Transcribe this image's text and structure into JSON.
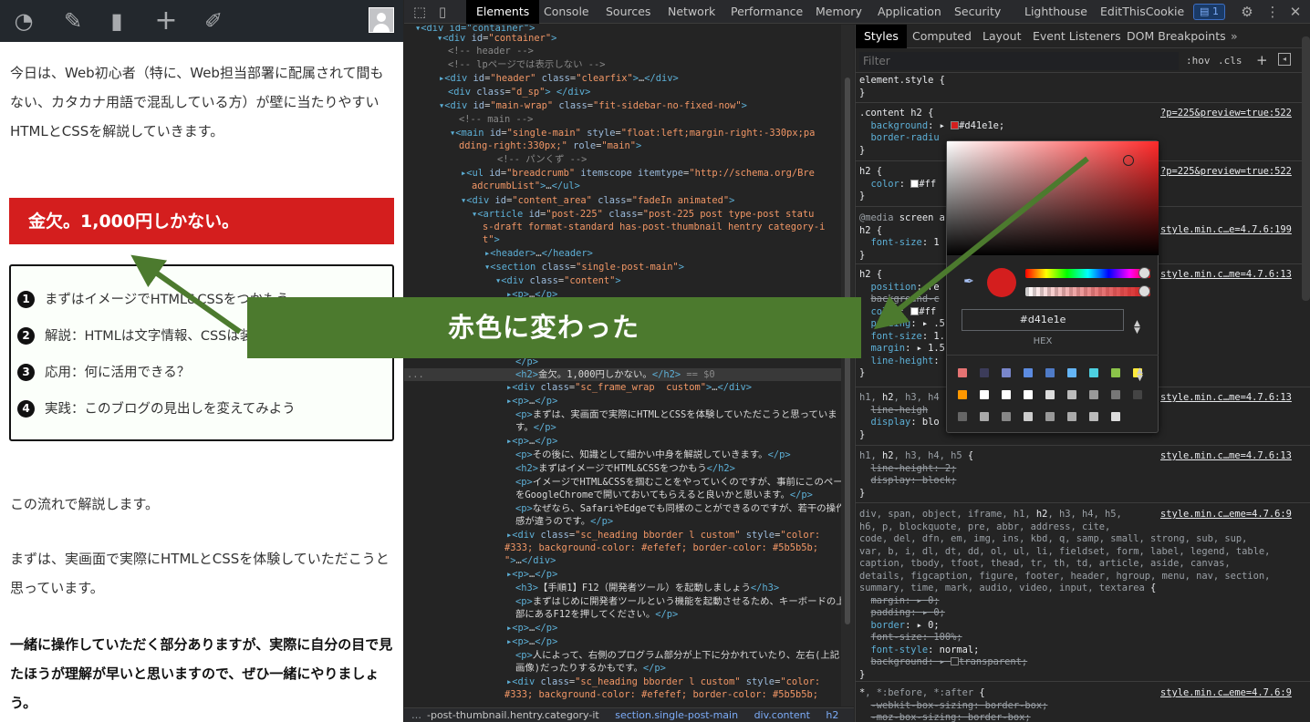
{
  "article": {
    "intro": "今日は、Web初心者（特に、Web担当部署に配属されて間もない、カタカナ用語で混乱している方）が壁に当たりやすいHTMLとCSSを解説していきます。",
    "heading": "金欠。1,000円しかない。",
    "toc": [
      {
        "num": "1",
        "text": "まずはイメージでHTML&CSSをつかもう"
      },
      {
        "num": "2",
        "text": "解説：HTMLは文字情報、CSSは装飾"
      },
      {
        "num": "3",
        "text": "応用：何に活用できる？"
      },
      {
        "num": "4",
        "text": "実践：このブログの見出しを変えてみよう"
      }
    ],
    "p1": "この流れで解説します。",
    "p2": "まずは、実画面で実際にHTMLとCSSを体験していただこうと思っています。",
    "p3": "一緒に操作していただく部分ありますが、実際に自分の目で見たほうが理解が早いと思いますので、ぜひ一緒にやりましょう。"
  },
  "annotation": {
    "banner": "赤色に変わった",
    "color": "#4c7a2e"
  },
  "devtools": {
    "tabs": [
      "Elements",
      "Console",
      "Sources",
      "Network",
      "Performance",
      "Memory",
      "Application",
      "Security",
      "Lighthouse",
      "EditThisCookie"
    ],
    "active_tab": "Elements",
    "message_count": "1",
    "styles_tabs": [
      "Styles",
      "Computed",
      "Layout",
      "Event Listeners",
      "DOM Breakpoints"
    ],
    "filter_placeholder": "Filter",
    "hov": ":hov",
    "cls": ".cls",
    "breadcrumb": [
      "-post-thumbnail.hentry.category-it",
      "section.single-post-main",
      "div.content",
      "h2"
    ],
    "selected_line": "<h2>金欠。1,000円しかない。</h2> == $0"
  },
  "picker": {
    "hex_value": "#d41e1e",
    "format_label": "HEX",
    "current_color": "#d41e1e",
    "palette": [
      "#e57373",
      "#3c3c5a",
      "#7986cb",
      "#5c8be0",
      "#4f7bc7",
      "#64b5f6",
      "#4dd0e1",
      "#8bc34a",
      "#ffeb3b",
      "#ff9800",
      "#ffffff",
      "#ffffff",
      "#ffffff",
      "#dddddd",
      "#bbbbbb",
      "#999999",
      "#777777",
      "#444444",
      "#666666",
      "#aaaaaa",
      "#888888",
      "#cccccc",
      "#999999",
      "#aaaaaa",
      "#bbbbbb",
      "#dddddd"
    ]
  }
}
